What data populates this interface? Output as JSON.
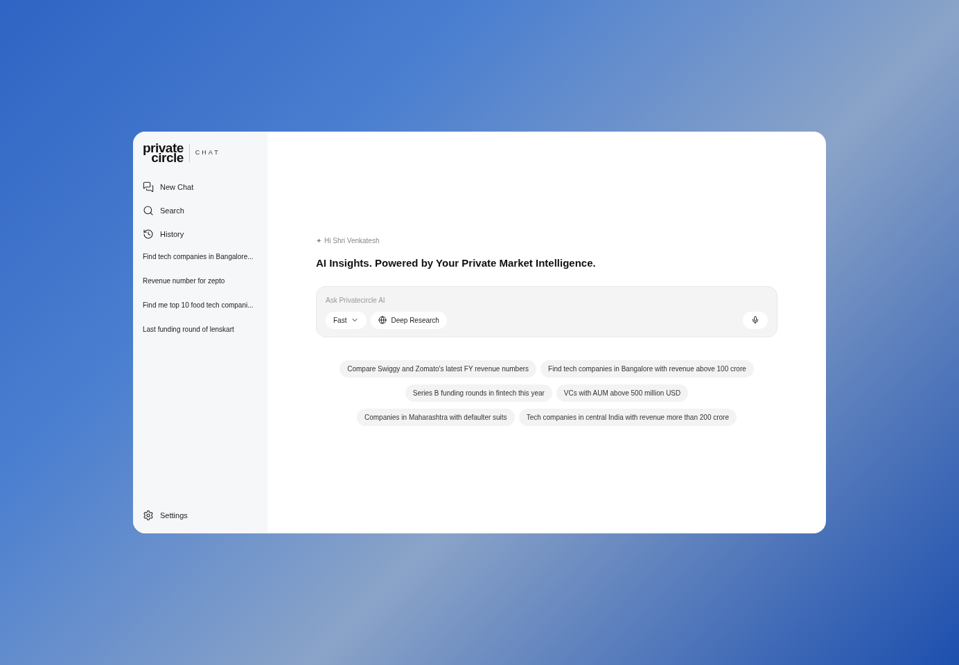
{
  "logo": {
    "line_1": "private",
    "line_2": "circle",
    "product": "CHAT"
  },
  "sidebar": {
    "nav": [
      {
        "kind": "new-chat",
        "label": "New Chat"
      },
      {
        "kind": "search",
        "label": "Search"
      },
      {
        "kind": "history",
        "label": "History"
      }
    ],
    "history_items": [
      "Find tech companies in Bangalore...",
      "Revenue number for zepto",
      "Find me top 10 food tech compani...",
      "Last funding round of lenskart"
    ],
    "settings": "Settings"
  },
  "main": {
    "greeting_icon": "✦",
    "greeting": "Hi Shri Venkatesh",
    "headline": "AI Insights. Powered by Your Private Market Intelligence.",
    "prompt": {
      "placeholder": "Ask Privatecircle AI",
      "mode": "Fast",
      "deep_research": "Deep Research"
    },
    "suggestion_rows": [
      [
        "Compare Swiggy and Zomato's latest FY revenue numbers",
        "Find tech companies in Bangalore with revenue above 100 crore"
      ],
      [
        "Series B funding rounds in fintech this year",
        "VCs with AUM above 500 million USD"
      ],
      [
        "Companies in Maharashtra with defaulter suits",
        "Tech companies in central India with revenue more than 200 crore"
      ]
    ]
  }
}
